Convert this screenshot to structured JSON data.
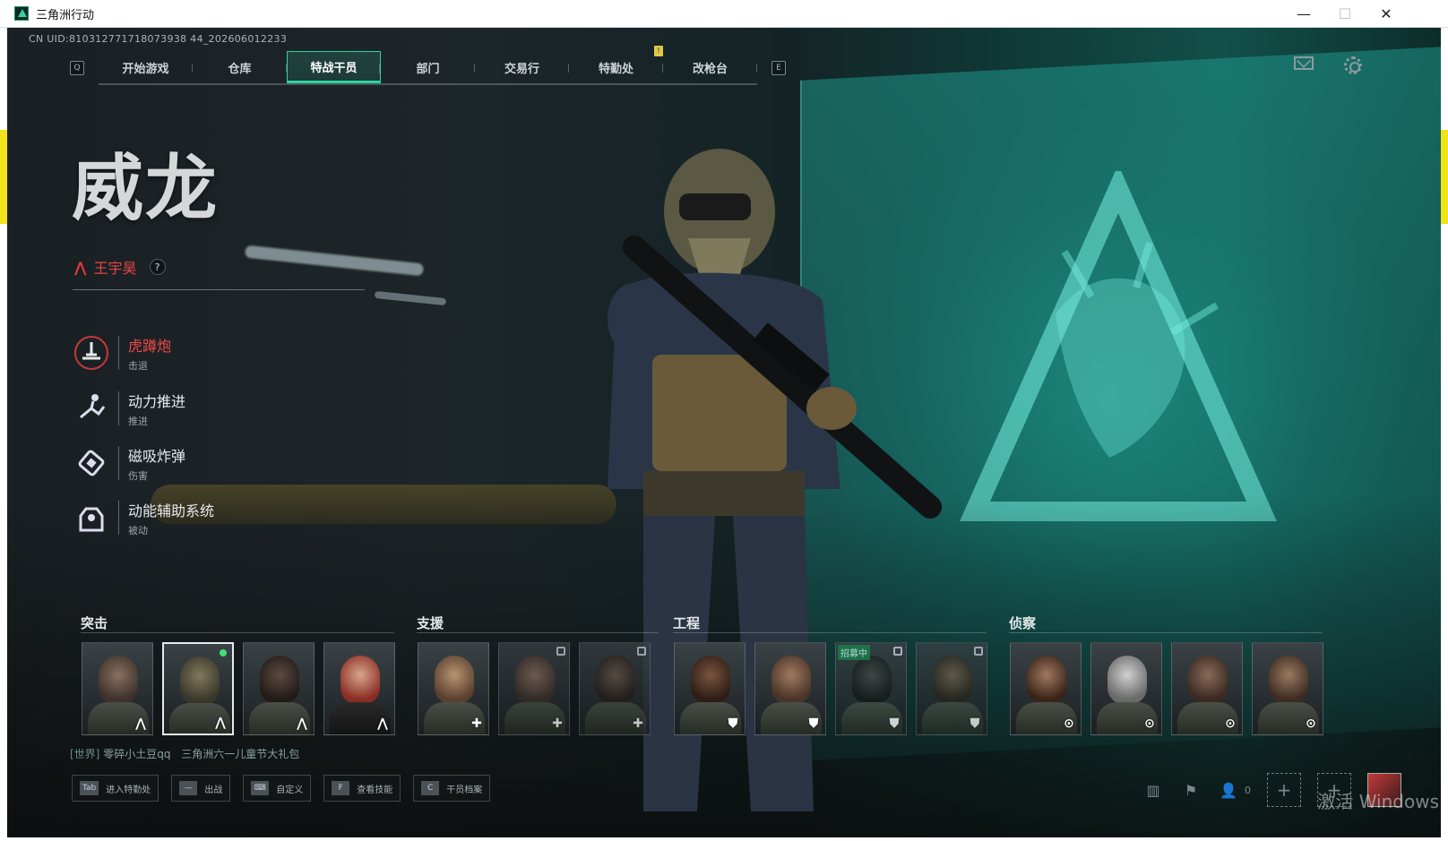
{
  "window": {
    "title": "三角洲行动",
    "minimize": "—",
    "maximize": "☐",
    "close": "✕"
  },
  "uid": "CN UID:810312771718073938 44_202606012233",
  "nav": {
    "left_key": "Q",
    "right_key": "E",
    "tabs": [
      "开始游戏",
      "仓库",
      "特战干员",
      "部门",
      "交易行",
      "特勤处",
      "改枪台"
    ],
    "active_index": 2,
    "notif_badge": "!"
  },
  "operator": {
    "codename": "威龙",
    "real_name": "王宇昊",
    "help": "?"
  },
  "skills": [
    {
      "name": "虎蹲炮",
      "type": "击退",
      "icon": "cannon-icon",
      "active": true
    },
    {
      "name": "动力推进",
      "type": "推进",
      "icon": "dash-icon",
      "active": false
    },
    {
      "name": "磁吸炸弹",
      "type": "伤害",
      "icon": "grenade-icon",
      "active": false
    },
    {
      "name": "动能辅助系统",
      "type": "被动",
      "icon": "exosuit-icon",
      "active": false
    }
  ],
  "classes": [
    {
      "name": "突击",
      "role_icon": "⋀",
      "cards": [
        {
          "locked": false,
          "selected": false
        },
        {
          "locked": false,
          "selected": true,
          "online_dot": true
        },
        {
          "locked": false,
          "selected": false
        },
        {
          "locked": false,
          "selected": false
        }
      ]
    },
    {
      "name": "支援",
      "role_icon": "✚",
      "cards": [
        {
          "locked": false
        },
        {
          "locked": true
        },
        {
          "locked": true
        }
      ]
    },
    {
      "name": "工程",
      "role_icon": "⛊",
      "cards": [
        {
          "locked": false
        },
        {
          "locked": false
        },
        {
          "locked": true,
          "tag": "招募中"
        },
        {
          "locked": true
        }
      ]
    },
    {
      "name": "侦察",
      "role_icon": "⊙",
      "cards": [
        {
          "locked": false
        },
        {
          "locked": false
        },
        {
          "locked": false
        },
        {
          "locked": false
        }
      ]
    }
  ],
  "chat": {
    "channel": "[世界]",
    "user": "零碎小土豆qq",
    "message": "三角洲六一儿童节大礼包"
  },
  "bottom_buttons": [
    {
      "key": "Tab",
      "label": "进入特勤处"
    },
    {
      "key": "—",
      "label": "出战"
    },
    {
      "key": "⌨",
      "label": "自定义"
    },
    {
      "key": "F",
      "label": "查看技能"
    },
    {
      "key": "C",
      "label": "干员档案"
    }
  ],
  "friends_count": "0",
  "watermark": "激活 Windows"
}
